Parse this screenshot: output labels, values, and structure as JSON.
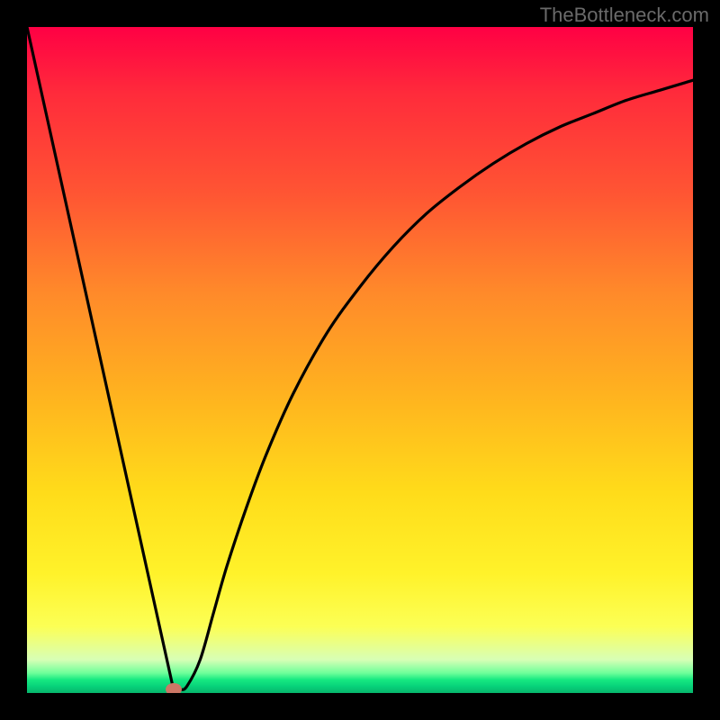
{
  "watermark": "TheBottleneck.com",
  "colors": {
    "frame": "#000000",
    "curve_stroke": "#000000",
    "marker": "#cc7766",
    "gradient_top": "#ff0044",
    "gradient_bottom": "#07b56c"
  },
  "chart_data": {
    "type": "line",
    "title": "",
    "xlabel": "",
    "ylabel": "",
    "xlim": [
      0,
      100
    ],
    "ylim": [
      0,
      100
    ],
    "grid": false,
    "legend": false,
    "x": [
      0,
      5,
      10,
      15,
      19,
      21,
      22,
      23,
      24,
      26,
      28,
      30,
      33,
      36,
      40,
      45,
      50,
      55,
      60,
      65,
      70,
      75,
      80,
      85,
      90,
      95,
      100
    ],
    "y": [
      100,
      76,
      52,
      28,
      8,
      0.7,
      0.5,
      0.5,
      1,
      5,
      12,
      19,
      28,
      36,
      45,
      54,
      61,
      67,
      72,
      76,
      79.5,
      82.5,
      85,
      87,
      89,
      90.5,
      92
    ],
    "marker": {
      "x": 22,
      "y": 0.5
    },
    "note": "Values estimated from pixel positions on an unlabeled 0–100 normalized axes; curve depicts a sharp V-shaped minimum near x≈22 with a gradually rising asymptotic right branch over a vertical red→green gradient background."
  }
}
